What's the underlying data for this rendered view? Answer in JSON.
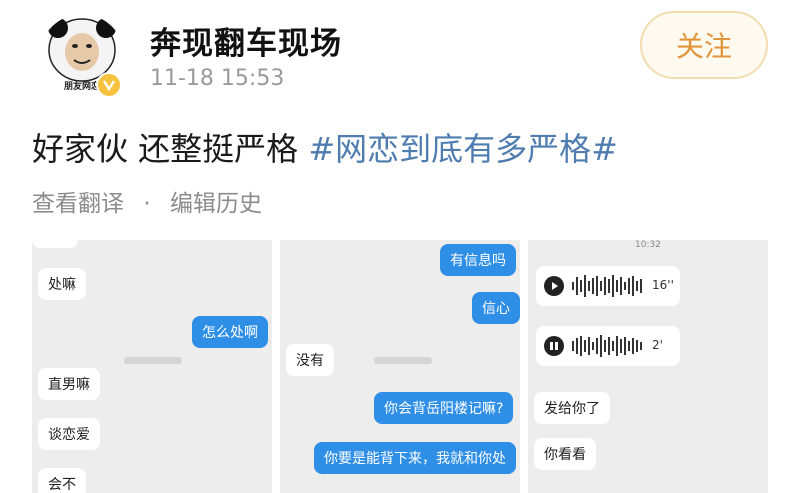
{
  "post": {
    "avatar_caption": "朋友网恋",
    "username": "奔现翻车现场",
    "timestamp": "11-18 15:53",
    "follow_label": "关注",
    "text": "好家伙 还整挺严格",
    "hashtag": "#网恋到底有多严格#",
    "actions": {
      "translate": "查看翻译",
      "separator": "·",
      "history": "编辑历史"
    }
  },
  "images": [
    {
      "messages": [
        {
          "side": "left",
          "text": "处嘛"
        },
        {
          "side": "right",
          "text": "怎么处啊"
        },
        {
          "side": "left",
          "text": "直男嘛"
        },
        {
          "side": "left",
          "text": "谈恋爱"
        },
        {
          "side": "left",
          "text": "会不"
        }
      ]
    },
    {
      "messages": [
        {
          "side": "right",
          "text": "有信息吗"
        },
        {
          "side": "right",
          "text": "信心"
        },
        {
          "side": "left",
          "text": "没有"
        },
        {
          "side": "right",
          "text": "你会背岳阳楼记嘛?"
        },
        {
          "side": "right",
          "text": "你要是能背下来，我就和你处"
        }
      ]
    },
    {
      "status_time": "10:32",
      "voice_messages": [
        {
          "state": "play",
          "duration": "16''"
        },
        {
          "state": "pause",
          "duration": "2'"
        }
      ],
      "messages": [
        {
          "side": "left",
          "text": "发给你了"
        },
        {
          "side": "left",
          "text": "你看看"
        }
      ]
    }
  ],
  "colors": {
    "hashtag": "#4f7db0",
    "follow": "#e0963a",
    "bubble_right": "#2f8fe6",
    "badge": "#f6c23e"
  },
  "icons": [
    "panda-meme-avatar-icon",
    "verified-badge-icon",
    "play-icon",
    "pause-icon",
    "waveform-icon"
  ]
}
